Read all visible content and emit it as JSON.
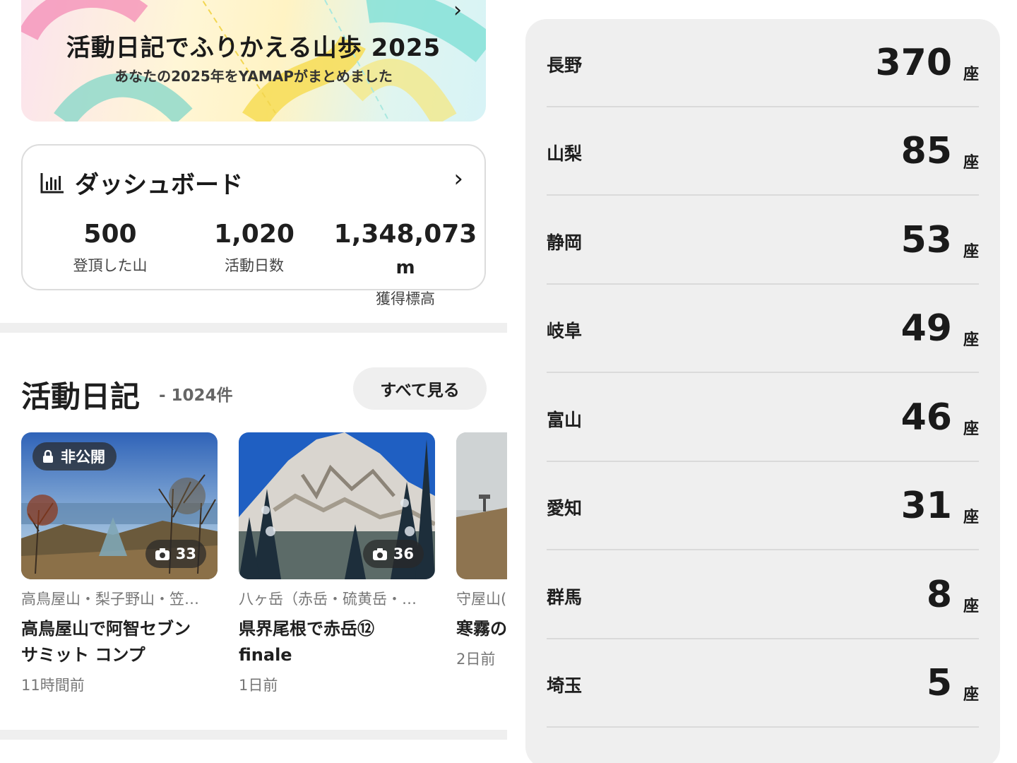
{
  "banner": {
    "title": "活動日記でふりかえる山歩 2025",
    "subtitle": "あなたの2025年をYAMAPがまとめました"
  },
  "dashboard": {
    "title": "ダッシュボード",
    "stats": [
      {
        "value": "500",
        "label": "登頂した山"
      },
      {
        "value": "1,020",
        "label": "活動日数"
      },
      {
        "value": "1,348,073",
        "unit": "m",
        "label": "獲得標高"
      }
    ]
  },
  "activity": {
    "title": "活動日記",
    "count": "- 1024件",
    "see_all": "すべて見る",
    "cards": [
      {
        "badge": "非公開",
        "photos": "33",
        "mountain": "高鳥屋山・梨子野山・笠…",
        "title": "高鳥屋山で阿智セブン\nサミット コンプ",
        "time": "11時間前"
      },
      {
        "photos": "36",
        "mountain": "八ヶ岳（赤岳・硫黄岳・…",
        "title": "県界尾根で赤岳⑫\nfinale",
        "time": "1日前"
      },
      {
        "mountain": "守屋山(",
        "title": "寒霧の",
        "time": "2日前"
      }
    ]
  },
  "prefectures": {
    "unit": "座",
    "rows": [
      {
        "name": "長野",
        "count": "370"
      },
      {
        "name": "山梨",
        "count": "85"
      },
      {
        "name": "静岡",
        "count": "53"
      },
      {
        "name": "岐阜",
        "count": "49"
      },
      {
        "name": "富山",
        "count": "46"
      },
      {
        "name": "愛知",
        "count": "31"
      },
      {
        "name": "群馬",
        "count": "8"
      },
      {
        "name": "埼玉",
        "count": "5"
      }
    ]
  },
  "icons": {
    "dashboard": "bar-chart-icon",
    "chevron": "chevron-right-icon",
    "lock": "lock-icon",
    "camera": "camera-icon"
  }
}
